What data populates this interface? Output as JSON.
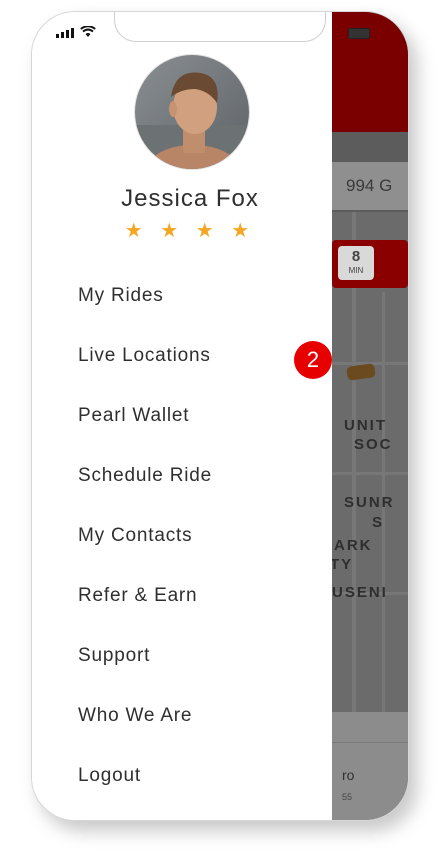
{
  "profile": {
    "name": "Jessica Fox",
    "stars": "★ ★ ★ ★"
  },
  "menu": {
    "items": [
      {
        "label": "My Rides"
      },
      {
        "label": "Live Locations",
        "badge": "2"
      },
      {
        "label": "Pearl Wallet"
      },
      {
        "label": "Schedule Ride"
      },
      {
        "label": "My Contacts"
      },
      {
        "label": "Refer & Earn"
      },
      {
        "label": "Support"
      },
      {
        "label": "Who We Are"
      },
      {
        "label": "Logout"
      }
    ]
  },
  "background_app": {
    "search_text": "994 G",
    "eta_value": "8",
    "eta_unit": "MIN",
    "map_labels": [
      "UNIT",
      "SOC",
      "SUNR",
      "S",
      "ARK",
      "TY",
      "USENI"
    ],
    "bottom_title": "ro",
    "bottom_sub": "55"
  },
  "colors": {
    "accent_red": "#e60000",
    "star_color": "#f5a623",
    "header_dark_red": "#7a0000"
  }
}
